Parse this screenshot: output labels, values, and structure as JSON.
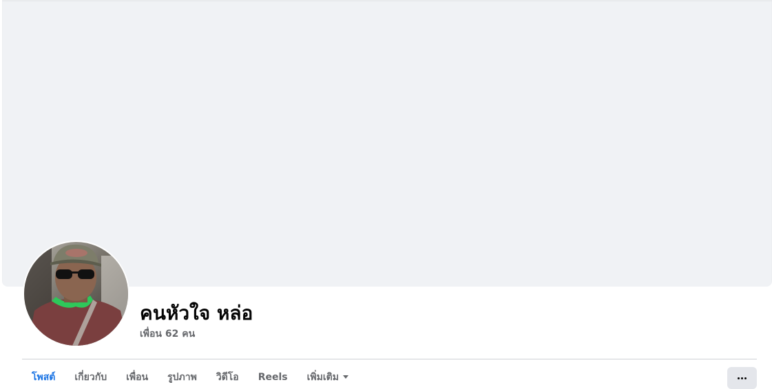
{
  "profile": {
    "name": "คนหัวใจ หล่อ",
    "friends": "เพื่อน 62 คน"
  },
  "tabs": [
    {
      "label": "โพสต์",
      "active": true
    },
    {
      "label": "เกี่ยวกับ",
      "active": false
    },
    {
      "label": "เพื่อน",
      "active": false
    },
    {
      "label": "รูปภาพ",
      "active": false
    },
    {
      "label": "วิดีโอ",
      "active": false
    },
    {
      "label": "Reels",
      "active": false
    },
    {
      "label": "เพิ่มเติม",
      "active": false,
      "dropdown": true
    }
  ],
  "icons": {
    "more_tab_caret": "caret-down-icon",
    "more_actions": "ellipsis-icon"
  },
  "colors": {
    "accent": "#1b74e4",
    "cover": "#f0f2f5",
    "secondary_text": "#65676b"
  }
}
